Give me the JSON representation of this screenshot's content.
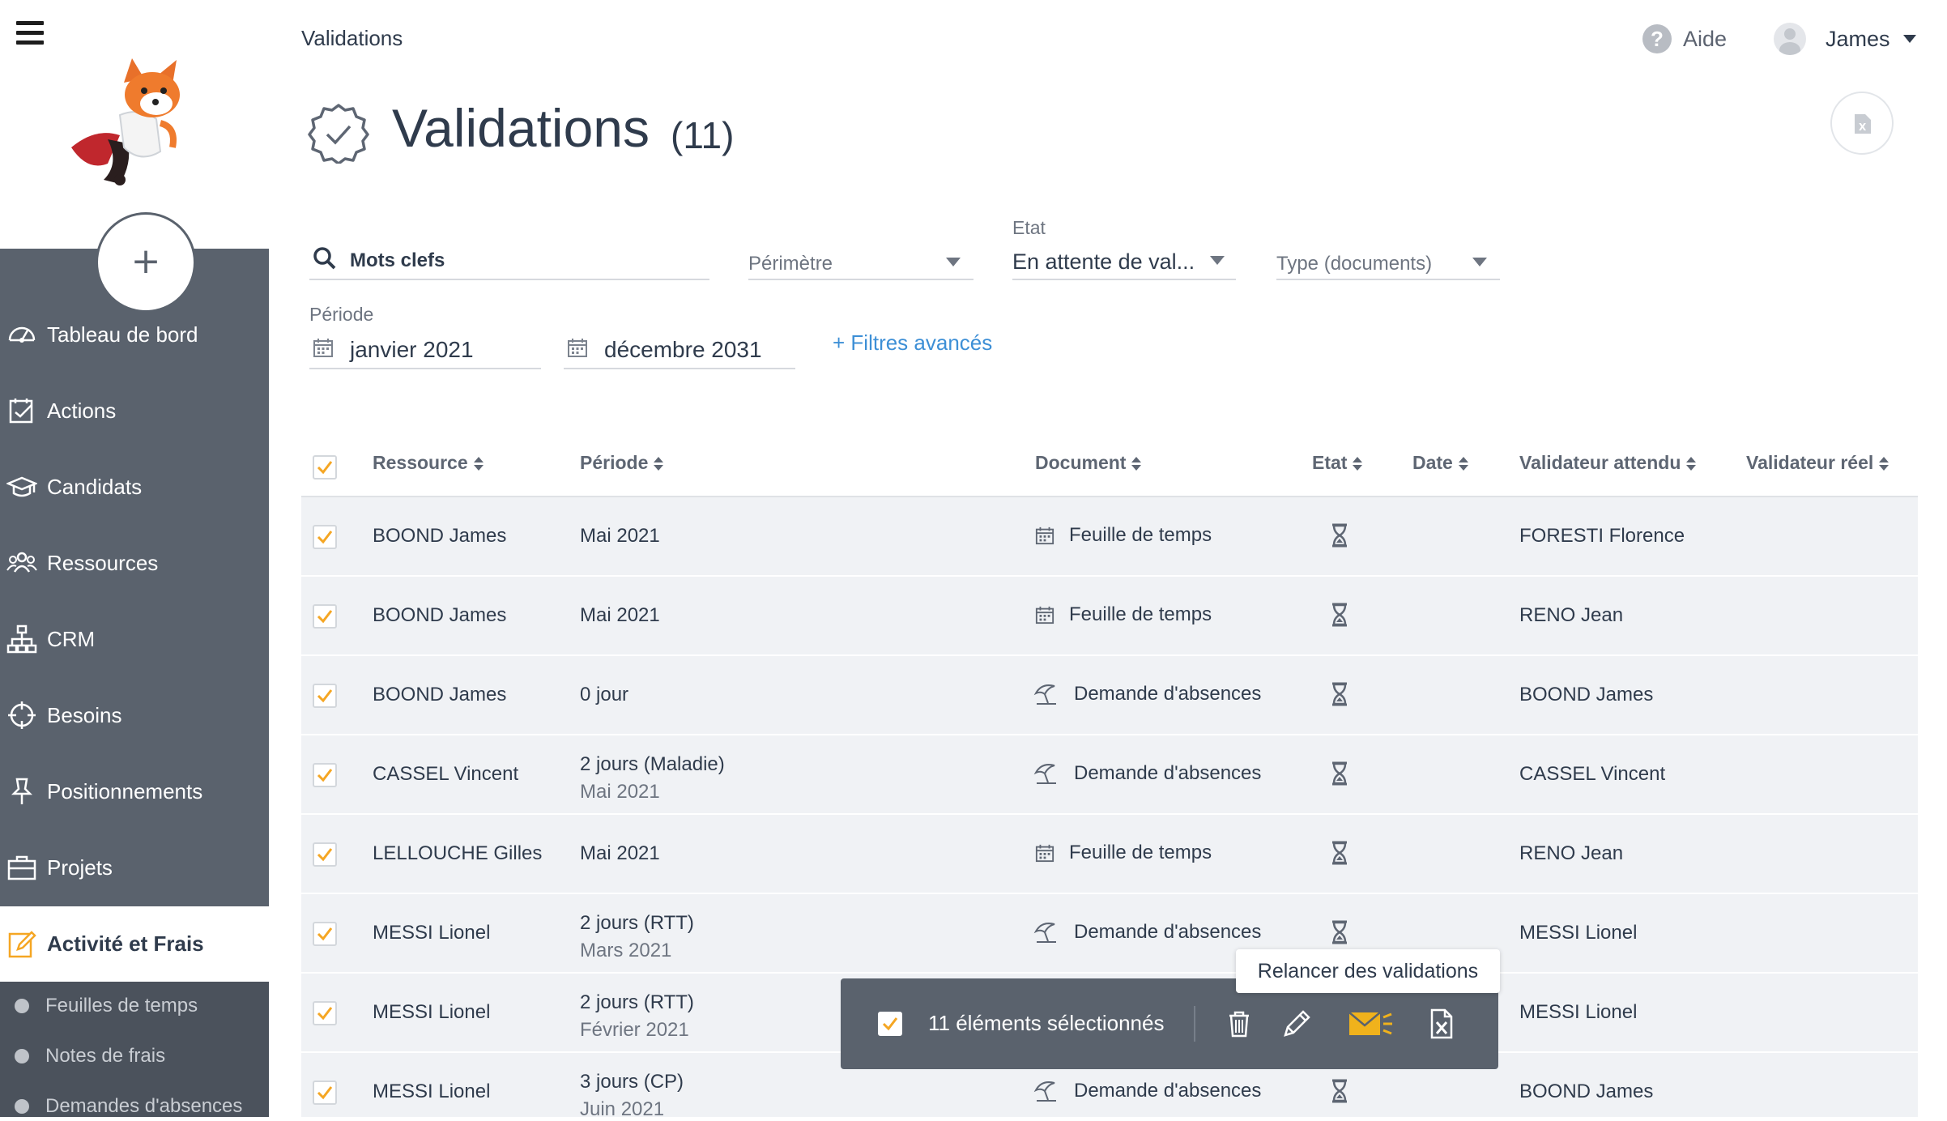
{
  "sidebar": {
    "items": [
      {
        "label": "Tableau de bord",
        "icon": "dashboard-icon"
      },
      {
        "label": "Actions",
        "icon": "checklist-icon"
      },
      {
        "label": "Candidats",
        "icon": "graduation-cap-icon"
      },
      {
        "label": "Ressources",
        "icon": "people-icon"
      },
      {
        "label": "CRM",
        "icon": "sitemap-icon"
      },
      {
        "label": "Besoins",
        "icon": "crosshair-icon"
      },
      {
        "label": "Positionnements",
        "icon": "pushpin-icon"
      },
      {
        "label": "Projets",
        "icon": "briefcase-icon"
      },
      {
        "label": "Activité et Frais",
        "icon": "edit-icon"
      }
    ],
    "sub_items": [
      "Feuilles de temps",
      "Notes de frais",
      "Demandes d'absences"
    ],
    "add_label": "+"
  },
  "header": {
    "breadcrumb": "Validations",
    "help_label": "Aide",
    "user_name": "James"
  },
  "page": {
    "title": "Validations",
    "count": "(11)"
  },
  "filters": {
    "keywords": "Mots clefs",
    "perimetre": "Périmètre",
    "etat_label": "Etat",
    "etat_value": "En attente de val...",
    "type": "Type (documents)",
    "periode_label": "Période",
    "start": "janvier 2021",
    "end": "décembre 2031",
    "advanced": "+ Filtres avancés"
  },
  "table": {
    "headers": [
      "Ressource",
      "Période",
      "Document",
      "Etat",
      "Date",
      "Validateur attendu",
      "Validateur réel"
    ],
    "rows": [
      {
        "ressource": "BOOND James",
        "periode": "Mai 2021",
        "periode2": "",
        "document": "Feuille de temps",
        "doctype": "calendar",
        "validateur": "FORESTI Florence"
      },
      {
        "ressource": "BOOND James",
        "periode": "Mai 2021",
        "periode2": "",
        "document": "Feuille de temps",
        "doctype": "calendar",
        "validateur": "RENO Jean"
      },
      {
        "ressource": "BOOND James",
        "periode": "0 jour",
        "periode2": "",
        "document": "Demande d'absences",
        "doctype": "umbrella",
        "validateur": "BOOND James"
      },
      {
        "ressource": "CASSEL Vincent",
        "periode": "2 jours (Maladie)",
        "periode2": "Mai 2021",
        "document": "Demande d'absences",
        "doctype": "umbrella",
        "validateur": "CASSEL Vincent"
      },
      {
        "ressource": "LELLOUCHE Gilles",
        "periode": "Mai 2021",
        "periode2": "",
        "document": "Feuille de temps",
        "doctype": "calendar",
        "validateur": "RENO Jean"
      },
      {
        "ressource": "MESSI Lionel",
        "periode": "2 jours (RTT)",
        "periode2": "Mars 2021",
        "document": "Demande d'absences",
        "doctype": "umbrella",
        "validateur": "MESSI Lionel"
      },
      {
        "ressource": "MESSI Lionel",
        "periode": "2 jours (RTT)",
        "periode2": "Février 2021",
        "document": "",
        "doctype": "",
        "validateur": "MESSI Lionel"
      },
      {
        "ressource": "MESSI Lionel",
        "periode": "3 jours (CP)",
        "periode2": "Juin 2021",
        "document": "Demande d'absences",
        "doctype": "umbrella",
        "validateur": "BOOND James"
      }
    ]
  },
  "selection": {
    "text": "11 éléments sélectionnés",
    "tooltip": "Relancer des validations"
  },
  "colors": {
    "sidebar": "#5a626d",
    "accent_orange": "#f5a623",
    "link_blue": "#3d8fd6",
    "row_bg": "#f0f2f5",
    "email_icon": "#f0b21c"
  }
}
